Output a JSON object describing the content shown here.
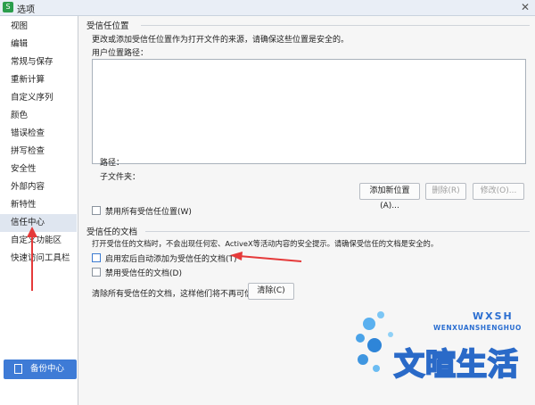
{
  "window": {
    "title": "选项",
    "close_glyph": "✕"
  },
  "sidebar": {
    "items": [
      {
        "label": "视图"
      },
      {
        "label": "编辑"
      },
      {
        "label": "常规与保存"
      },
      {
        "label": "重新计算"
      },
      {
        "label": "自定义序列"
      },
      {
        "label": "颜色"
      },
      {
        "label": "错误检查"
      },
      {
        "label": "拼写检查"
      },
      {
        "label": "安全性"
      },
      {
        "label": "外部内容"
      },
      {
        "label": "新特性"
      },
      {
        "label": "信任中心",
        "active": true
      },
      {
        "label": "自定义功能区"
      },
      {
        "label": "快速访问工具栏"
      }
    ],
    "backup_label": "备份中心"
  },
  "trusted_locations": {
    "title": "受信任位置",
    "description": "更改或添加受信任位置作为打开文件的来源，请确保这些位置是安全的。",
    "user_path_label": "用户位置路径：",
    "path_label": "路径：",
    "subfolder_label": "子文件夹：",
    "add_button": "添加新位置(A)...",
    "delete_button": "删除(R)",
    "modify_button": "修改(O)...",
    "disable_all_label": "禁用所有受信任位置(W)"
  },
  "trusted_documents": {
    "title": "受信任的文档",
    "description": "打开受信任的文档时，不会出现任何宏、ActiveX等活动内容的安全提示。请确保受信任的文档是安全的。",
    "auto_add_label": "启用宏后自动添加为受信任的文档(T)",
    "disable_label": "禁用受信任的文档(D)",
    "clear_text": "清除所有受信任的文档，这样他们将不再可信",
    "clear_button": "清除(C)"
  },
  "watermark": {
    "letters": "WXSH",
    "pinyin": "WENXUANSHENGHUO",
    "text": "文暄生活"
  },
  "colors": {
    "accent": "#3e7bd6",
    "arrow": "#e53a3a",
    "sidebar_active": "#dfe6f0"
  }
}
